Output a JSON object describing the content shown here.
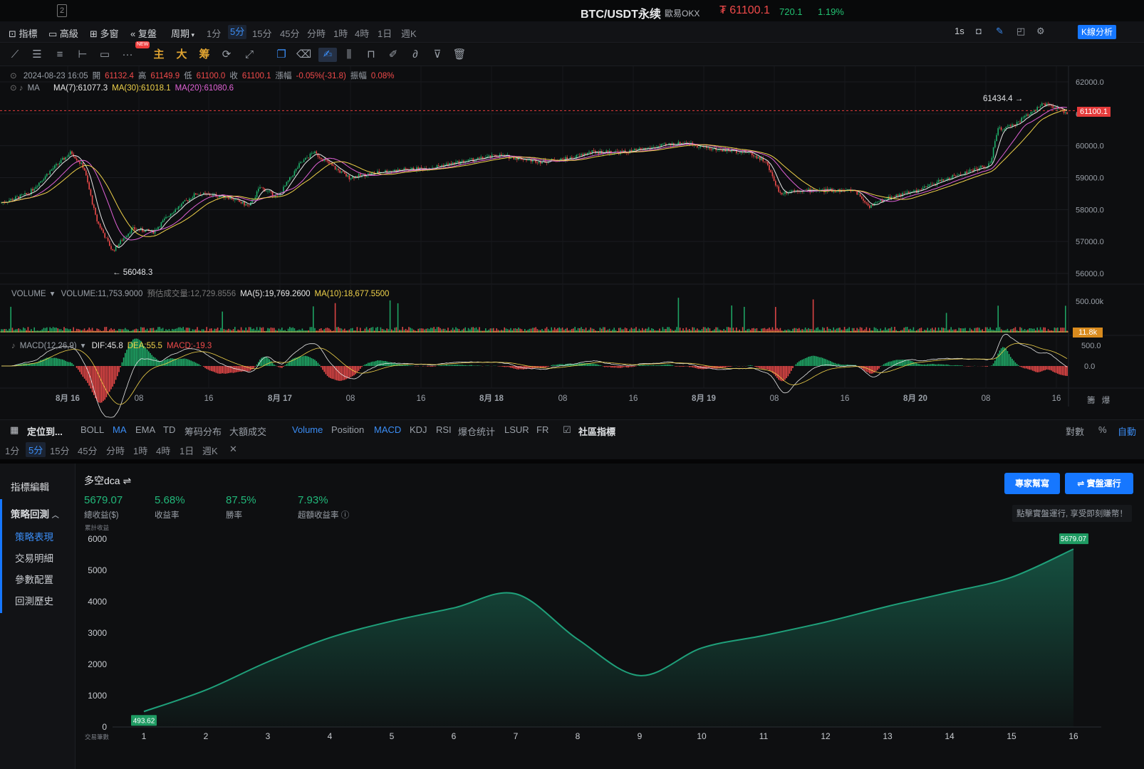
{
  "title": {
    "window_icon": "2",
    "symbol": "BTC/USDT永续",
    "exchange": "歐易OKX",
    "price": "₮ 61100.1",
    "change": "720.1",
    "change_pct": "1.19%"
  },
  "menu": {
    "indicators": "指標",
    "advanced": "高級",
    "multi": "多窗",
    "replay": "复盤",
    "period": "周期",
    "periods": [
      "1分",
      "5分",
      "15分",
      "45分",
      "分時",
      "1時",
      "4時",
      "1日",
      "週K"
    ],
    "active_period": "5分",
    "interval": "1s",
    "k_analysis": "K線分析"
  },
  "toolbar": {
    "new_badge": "NEW",
    "main": "主",
    "big": "大",
    "chip": "筹"
  },
  "candle_chart": {
    "ohlc_date": "2024-08-23 16:05",
    "open_label": "開",
    "open": "61132.4",
    "high_label": "高",
    "high": "61149.9",
    "low_label": "低",
    "low": "61100.0",
    "close_label": "收",
    "close": "61100.1",
    "change_label": "漲幅",
    "change": "-0.05%(-31.8)",
    "amp_label": "振幅",
    "amp": "0.08%",
    "ma_label": "MA",
    "ma7": "MA(7):61077.3",
    "ma30": "MA(30):61018.1",
    "ma20": "MA(20):61080.6",
    "price_ticks": [
      "62000.0",
      "61000.0",
      "60000.0",
      "59000.0",
      "58000.0",
      "57000.0",
      "56000.0"
    ],
    "current_price_tag": "61100.1",
    "high_marker": "61434.4 →",
    "low_marker": "← 56048.3",
    "volume_label": "VOLUME",
    "volume_value": "VOLUME:11,753.9000",
    "volume_est": "預估成交量:12,729.8556",
    "vol_ma5": "MA(5):19,769.2600",
    "vol_ma10": "MA(10):18,677.5500",
    "volume_ticks": [
      "500.00k"
    ],
    "volume_tag": "11.8k",
    "macd_label": "MACD(12,26,9)",
    "dif": "DIF:45.8",
    "dea": "DEA:55.5",
    "macd": "MACD:-19.3",
    "macd_ticks": [
      "500.0",
      "0.0"
    ],
    "x_ticks": [
      "8月 16",
      "08",
      "16",
      "8月 17",
      "08",
      "16",
      "8月 18",
      "08",
      "16",
      "8月 19",
      "08",
      "16",
      "8月 20",
      "08",
      "16"
    ],
    "chip_label": "籌",
    "burst_label": "爆"
  },
  "indicator_bar": {
    "locate": "定位到...",
    "tabs": [
      "BOLL",
      "MA",
      "EMA",
      "TD",
      "筹码分布",
      "大額成交",
      "Volume",
      "Position",
      "MACD",
      "KDJ",
      "RSI",
      "爆仓统计",
      "LSUR",
      "FR"
    ],
    "community": "社區指標",
    "log": "對數",
    "percent": "%",
    "auto": "自動"
  },
  "period_bar": {
    "periods": [
      "1分",
      "5分",
      "15分",
      "45分",
      "分時",
      "1時",
      "4時",
      "1日",
      "週K"
    ],
    "active": "5分"
  },
  "left_nav": {
    "edit": "指標編輯",
    "backtest": "策略回測",
    "items": [
      "策略表現",
      "交易明細",
      "參數配置",
      "回測歷史"
    ],
    "active": "策略表現"
  },
  "strategy": {
    "name": "多空dca ⇌",
    "stats": [
      {
        "value": "5679.07",
        "label": "總收益($)"
      },
      {
        "value": "5.68%",
        "label": "收益率"
      },
      {
        "value": "87.5%",
        "label": "勝率"
      },
      {
        "value": "7.93%",
        "label": "超額收益率"
      }
    ],
    "expert_button": "專家幫寫",
    "live_button": "⇌ 實盤運行",
    "tip": "點擊實盤運行, 享受即刻賺幣！"
  },
  "chart_data": {
    "type": "area",
    "title": "",
    "ylabel": "累計收益",
    "xlabel": "交易筆數",
    "x": [
      1,
      2,
      3,
      4,
      5,
      6,
      7,
      8,
      9,
      10,
      11,
      12,
      13,
      14,
      15,
      16
    ],
    "values": [
      493.62,
      1180,
      2080,
      2850,
      3380,
      3800,
      4250,
      2800,
      1640,
      2520,
      2920,
      3350,
      3850,
      4300,
      4780,
      5679.07
    ],
    "ylim": [
      0,
      6000
    ],
    "yticks": [
      "0",
      "1000",
      "2000",
      "3000",
      "4000",
      "5000",
      "6000"
    ],
    "start_label": "493.62",
    "end_label": "5679.07",
    "color": "#1fa07a"
  }
}
